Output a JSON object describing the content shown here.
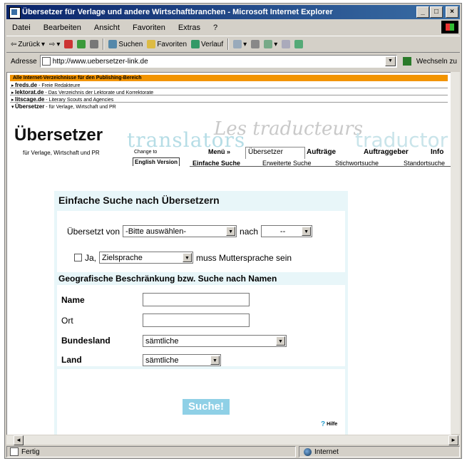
{
  "window": {
    "title": "Übersetzer für Verlage und andere Wirtschaftbranchen - Microsoft Internet Explorer"
  },
  "menubar": [
    "Datei",
    "Bearbeiten",
    "Ansicht",
    "Favoriten",
    "Extras",
    "?"
  ],
  "toolbar": {
    "back": "Zurück",
    "search": "Suchen",
    "favorites": "Favoriten",
    "history": "Verlauf"
  },
  "addressbar": {
    "label": "Adresse",
    "url": "http://www.uebersetzer-link.de",
    "go": "Wechseln zu"
  },
  "sitenav": {
    "banner": "Alle Internet-Verzeichnisse für den Publishing-Bereich",
    "rows": [
      {
        "name": "freds.de",
        "desc": " - Freie Redakteure"
      },
      {
        "name": "lektorat.de",
        "desc": " - Das Verzeichnis der Lektorate und Korrektorate"
      },
      {
        "name": "litscage.de",
        "desc": " - Literary Scouts and Agencies"
      },
      {
        "name": "Übersetzer",
        "desc": " - für Verlage, Wirtschaft und PR"
      }
    ]
  },
  "logo": {
    "main": "Übersetzer",
    "translators": "translators",
    "les": "Les traducteurs",
    "traductor": "traductor",
    "tagline": "für Verlage, Wirtschaft und PR"
  },
  "topnav": {
    "change_to": "Change to",
    "english": "English Version",
    "menu": "Menü »",
    "items": [
      "Übersetzer",
      "Aufträge",
      "Auftraggeber",
      "Info"
    ]
  },
  "subnav": [
    "Einfache Suche",
    "Erweiterte Suche",
    "Stichwortsuche",
    "Standortsuche"
  ],
  "form": {
    "title": "Einfache Suche nach Übersetzern",
    "translated_from_label": "Übersetzt von",
    "from_select": "-Bitte auswählen-",
    "to_label": "nach",
    "to_select": "--",
    "ja_label": "Ja,",
    "target_select": "Zielsprache",
    "native_text": "muss Muttersprache sein",
    "geo_heading": "Geografische Beschränkung bzw. Suche nach Namen",
    "name_label": "Name",
    "ort_label": "Ort",
    "bundesland_label": "Bundesland",
    "bundesland_select": "sämtliche",
    "land_label": "Land",
    "land_select": "sämtliche",
    "search_button": "Suche!",
    "help": "Hilfe"
  },
  "status": {
    "left": "Fertig",
    "zone": "Internet"
  }
}
